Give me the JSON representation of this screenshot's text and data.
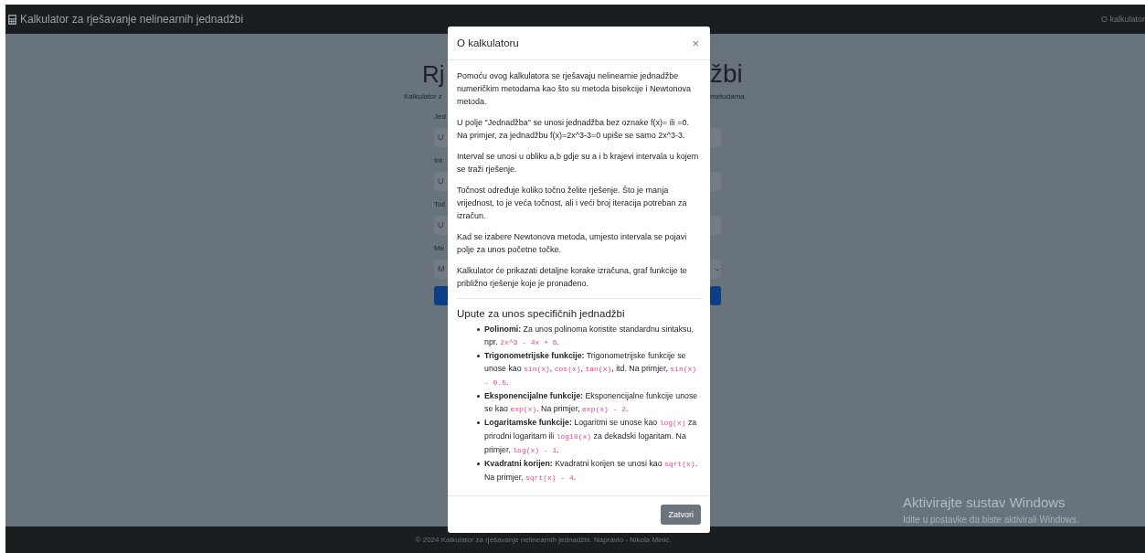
{
  "navbar": {
    "brand": "Kalkulator za rješavanje nelinearnih jednadžbi",
    "link": "O kalkulator"
  },
  "background_form": {
    "left": {
      "heading": "Rj",
      "subtitle": "Kalkulator z"
    },
    "right": {
      "heading": "žbi",
      "subtitle": "metodama."
    },
    "fields": [
      {
        "kind": "input",
        "label": "Jed",
        "placeholder": "U"
      },
      {
        "kind": "input",
        "label": "Int",
        "placeholder": "U"
      },
      {
        "kind": "input",
        "label": "Toč",
        "placeholder": "U"
      },
      {
        "kind": "select",
        "label": "Me",
        "value": "M"
      },
      {
        "kind": "button"
      }
    ]
  },
  "modal": {
    "title": "O kalkulatoru",
    "close": "×",
    "paragraphs": [
      "Pomoću ovog kalkulatora se rješavaju nelinearnie jednadžbe numeričkim metodama kao što su metoda bisekcije i Newtonova metoda.",
      "U polje \"Jednadžba\" se unosi jednadžba bez oznake f(x)= ili =0. Na primjer, za jednadžbu f(x)=2x^3-3=0 upiše se samo 2x^3-3.",
      "Interval se unosi u obliku a,b gdje su a i b krajevi intervala u kojem se traži rješenje.",
      "Točnost određuje koliko točno želite rješenje. Što je manja vrijednost, to je veća točnost, ali i veći broj iteracija potreban za izračun.",
      "Kad se izabere Newtonova metoda, umjesto intervala se pojavi polje za unos početne točke.",
      "Kalkulator će prikazati detaljne korake izračuna, graf funkcije te približno rješenje koje je pronađeno."
    ],
    "section_title": "Upute za unos specifičnih jednadžbi",
    "tips": [
      {
        "term": "Polinomi:",
        "parts": [
          {
            "kind": "text",
            "text": " Za unos polinoma koristite standardnu sintaksu, npr. "
          },
          {
            "kind": "code",
            "text": "2x^3 - 4x + 6"
          },
          {
            "kind": "text",
            "text": "."
          }
        ]
      },
      {
        "term": "Trigonometrijske funkcije:",
        "parts": [
          {
            "kind": "text",
            "text": " Trigonometrijske funkcije se unose kao "
          },
          {
            "kind": "code",
            "text": "sin(x)"
          },
          {
            "kind": "text",
            "text": ", "
          },
          {
            "kind": "code",
            "text": "cos(x)"
          },
          {
            "kind": "text",
            "text": ", "
          },
          {
            "kind": "code",
            "text": "tan(x)"
          },
          {
            "kind": "text",
            "text": ", itd. Na primjer, "
          },
          {
            "kind": "code",
            "text": "sin(x) - 0.5"
          },
          {
            "kind": "text",
            "text": "."
          }
        ]
      },
      {
        "term": "Eksponencijalne funkcije:",
        "parts": [
          {
            "kind": "text",
            "text": " Eksponencijalne funkcije unose se kao "
          },
          {
            "kind": "code",
            "text": "exp(x)"
          },
          {
            "kind": "text",
            "text": ". Na primjer, "
          },
          {
            "kind": "code",
            "text": "exp(x) - 2"
          },
          {
            "kind": "text",
            "text": "."
          }
        ]
      },
      {
        "term": "Logaritamske funkcije:",
        "parts": [
          {
            "kind": "text",
            "text": " Logaritmi se unose kao "
          },
          {
            "kind": "code",
            "text": "log(x)"
          },
          {
            "kind": "text",
            "text": " za prirodni logaritam ili "
          },
          {
            "kind": "code",
            "text": "log10(x)"
          },
          {
            "kind": "text",
            "text": " za dekadski logaritam. Na primjer, "
          },
          {
            "kind": "code",
            "text": "log(x) - 1"
          },
          {
            "kind": "text",
            "text": "."
          }
        ]
      },
      {
        "term": "Kvadratni korijen:",
        "parts": [
          {
            "kind": "text",
            "text": " Kvadratni korijen se unosi kao "
          },
          {
            "kind": "code",
            "text": "sqrt(x)"
          },
          {
            "kind": "text",
            "text": ". Na primjer, "
          },
          {
            "kind": "code",
            "text": "sqrt(x) - 4"
          },
          {
            "kind": "text",
            "text": "."
          }
        ]
      }
    ],
    "button": "Zatvori"
  },
  "footer": "© 2024 Kalkulator za rješavanje nelinearnih jednadžbi. Napravio - Nikola Minić.",
  "os_watermark": {
    "title": "Aktivirajte sustav Windows",
    "subtitle": "Idite u postavke da biste aktivirali Windows."
  }
}
